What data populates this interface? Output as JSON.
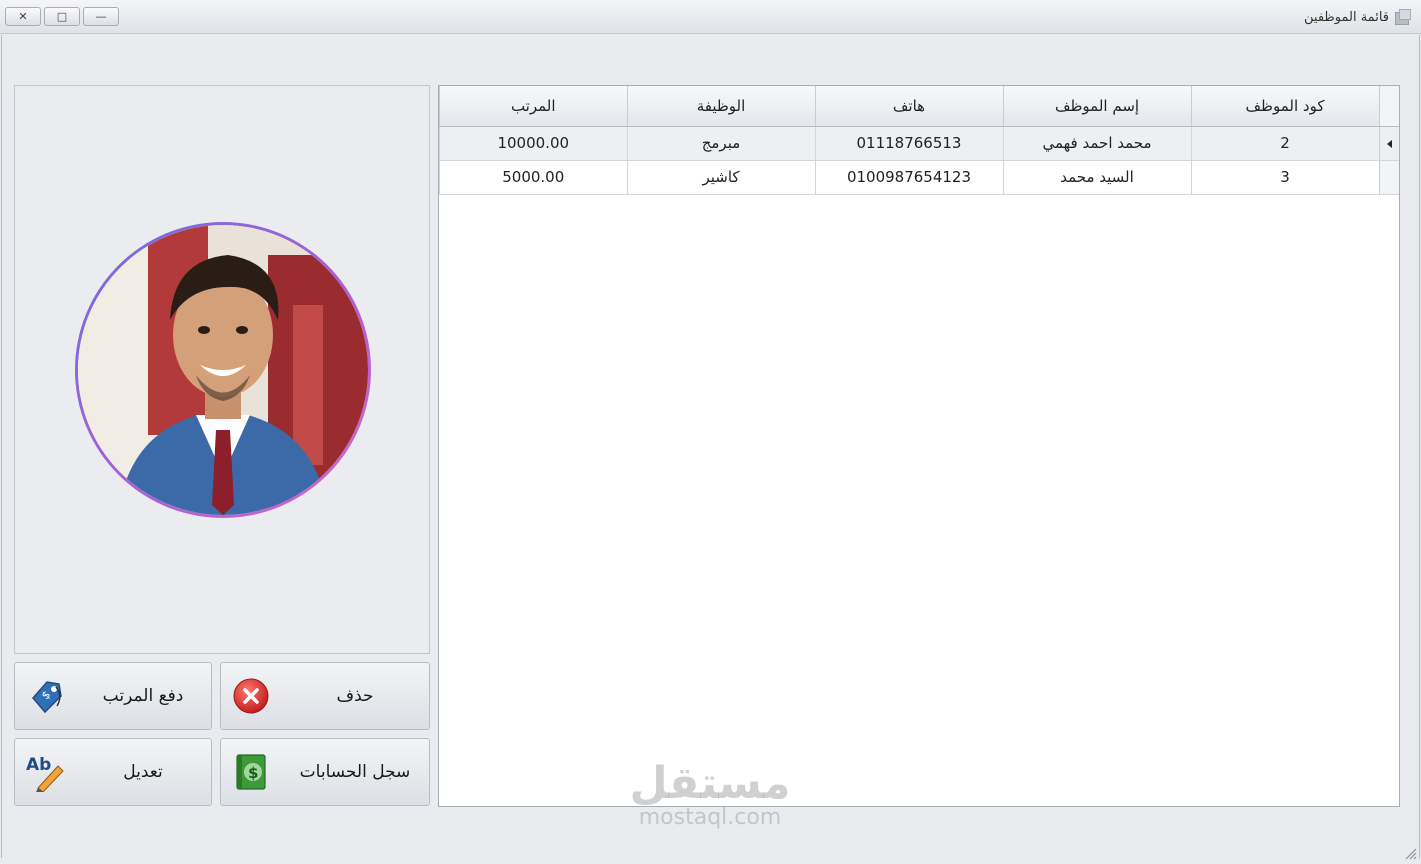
{
  "window": {
    "title": "قائمة الموظفين",
    "controls": {
      "close": "✕",
      "maximize": "□",
      "minimize": "—"
    }
  },
  "table": {
    "columns": [
      "كود الموظف",
      "إسم الموظف",
      "هاتف",
      "الوظيفة",
      "المرتب"
    ],
    "rows": [
      {
        "code": "2",
        "name": "محمد احمد فهمي",
        "phone": "01118766513",
        "job": "مبرمج",
        "salary": "10000.00",
        "selected": true
      },
      {
        "code": "3",
        "name": "السيد محمد",
        "phone": "0100987654123",
        "job": "كاشير",
        "salary": "5000.00",
        "selected": false
      }
    ]
  },
  "buttons": {
    "delete": "حذف",
    "pay_salary": "دفع المرتب",
    "accounts_log": "سجل الحسابات",
    "edit": "تعديل"
  },
  "icons": {
    "delete": "red-x-circle-icon",
    "pay_salary": "price-tag-icon",
    "accounts_log": "money-book-icon",
    "edit": "ab-pencil-icon"
  },
  "edit_icon_text": "Ab",
  "watermark": {
    "logo": "مستقل",
    "url": "mostaql.com"
  },
  "colors": {
    "delete_red": "#d9302f",
    "accent_blue": "#2f6fb5",
    "money_green": "#3c9a3a",
    "photo_ring": "#a866d6"
  }
}
